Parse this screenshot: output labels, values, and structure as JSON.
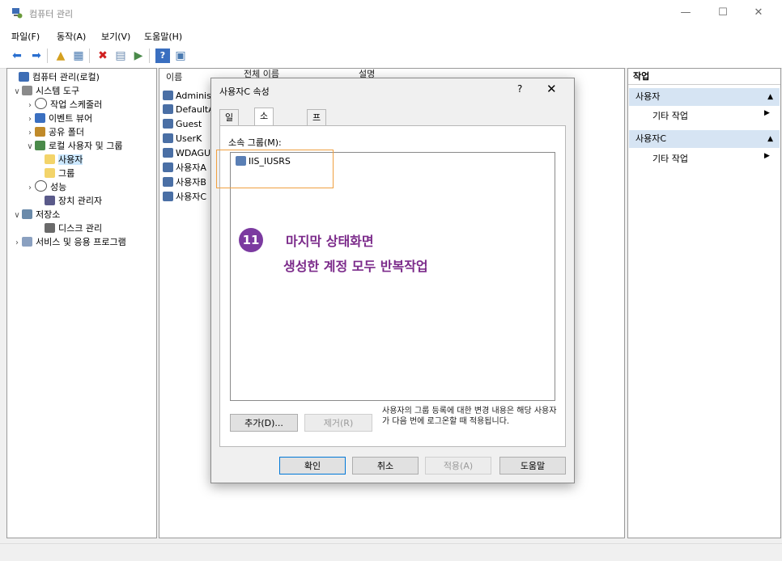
{
  "window": {
    "title": "컴퓨터 관리",
    "controls": {
      "minimize": "—",
      "maximize": "☐",
      "close": "✕"
    }
  },
  "menu": [
    "파일(F)",
    "동작(A)",
    "보기(V)",
    "도움말(H)"
  ],
  "toolbar_icons": [
    "back-icon",
    "forward-icon",
    "up-folder-icon",
    "show-hide-tree-icon",
    "delete-icon",
    "properties-icon",
    "export-icon",
    "help-icon",
    "show-hide-action-icon"
  ],
  "tree": [
    {
      "label": "컴퓨터 관리(로컬)",
      "expander": "",
      "icon": "computer-management-icon"
    },
    {
      "label": "시스템 도구",
      "expander": "∨",
      "icon": "system-tools-icon"
    },
    {
      "label": "작업 스케줄러",
      "expander": "›",
      "icon": "task-scheduler-icon"
    },
    {
      "label": "이벤트 뷰어",
      "expander": "›",
      "icon": "event-viewer-icon"
    },
    {
      "label": "공유 폴더",
      "expander": "›",
      "icon": "shared-folders-icon"
    },
    {
      "label": "로컬 사용자 및 그룹",
      "expander": "∨",
      "icon": "local-users-groups-icon"
    },
    {
      "label": "사용자",
      "expander": "",
      "icon": "folder-icon"
    },
    {
      "label": "그룹",
      "expander": "",
      "icon": "folder-icon"
    },
    {
      "label": "성능",
      "expander": "›",
      "icon": "performance-icon"
    },
    {
      "label": "장치 관리자",
      "expander": "",
      "icon": "device-manager-icon"
    },
    {
      "label": "저장소",
      "expander": "∨",
      "icon": "storage-icon"
    },
    {
      "label": "디스크 관리",
      "expander": "",
      "icon": "disk-management-icon"
    },
    {
      "label": "서비스 및 응용 프로그램",
      "expander": "›",
      "icon": "services-apps-icon"
    }
  ],
  "list": {
    "headers": [
      "이름",
      "전체 이름",
      "설명"
    ],
    "users": [
      "Adminis",
      "DefaultA",
      "Guest",
      "UserK",
      "WDAGU",
      "사용자A",
      "사용자B",
      "사용자C"
    ]
  },
  "actions": {
    "header": "작업",
    "sections": [
      {
        "title": "사용자",
        "item": "기타 작업"
      },
      {
        "title": "사용자C",
        "item": "기타 작업"
      }
    ]
  },
  "dialog": {
    "title": "사용자C 속성",
    "help": "?",
    "close": "✕",
    "tabs": [
      "일반",
      "소속 그룹",
      "프로필"
    ],
    "member_of_label": "소속 그룹(M):",
    "groups": [
      "IIS_IUSRS"
    ],
    "note": "사용자의 그룹 등록에 대한 변경 내용은 해당 사용자가 다음 번에 로그온할 때 적용됩니다.",
    "buttons": {
      "add": "추가(D)...",
      "remove": "제거(R)",
      "ok": "확인",
      "cancel": "취소",
      "apply": "적용(A)",
      "help": "도움말"
    }
  },
  "annotation": {
    "step": "11",
    "line1": "마지막 상태화면",
    "line2": "생성한 계정 모두 반복작업"
  }
}
